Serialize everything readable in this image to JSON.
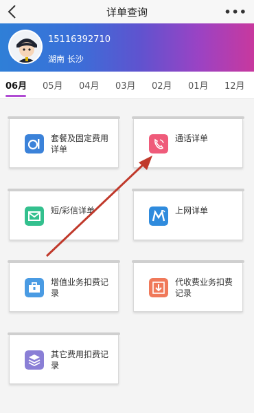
{
  "header": {
    "title": "详单查询",
    "more": "•••"
  },
  "user": {
    "phone": "15116392710",
    "location": "湖南 长沙"
  },
  "months": [
    "06月",
    "05月",
    "04月",
    "03月",
    "02月",
    "01月",
    "12月"
  ],
  "cards": {
    "package_fee": "套餐及固定费用详单",
    "call_detail": "通话详单",
    "sms_mms": "短/彩信详单",
    "internet": "上网详单",
    "value_added": "增值业务扣费记录",
    "collection": "代收费业务扣费记录",
    "other_fee": "其它费用扣费记录"
  },
  "colors": {
    "accent": "#b04bd3",
    "arrow": "#c0392b"
  }
}
